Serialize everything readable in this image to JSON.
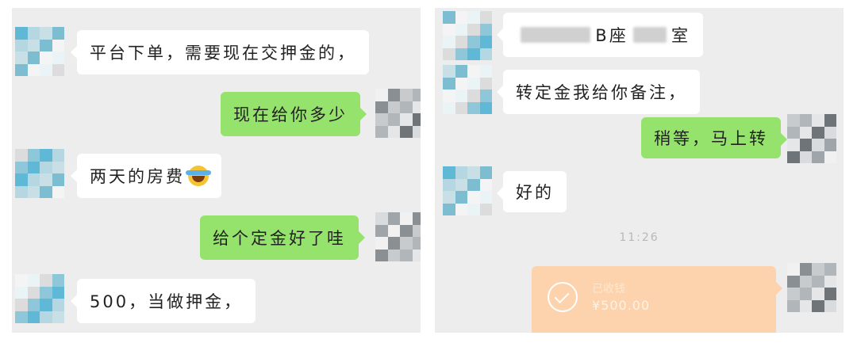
{
  "left_chat": {
    "messages": [
      {
        "side": "in",
        "text": "平台下单，需要现在交押金的，"
      },
      {
        "side": "out",
        "text": "现在给你多少"
      },
      {
        "side": "in",
        "text": "两天的房费",
        "emoji": "laughing-tears-emoji"
      },
      {
        "side": "out",
        "text": "给个定金好了哇"
      },
      {
        "side": "in",
        "text": "500，当做押金，"
      }
    ]
  },
  "right_chat": {
    "messages": [
      {
        "side": "in",
        "text_a": "B座",
        "text_b": "室",
        "redacted": true
      },
      {
        "side": "in",
        "text": "转定金我给你备注，"
      },
      {
        "side": "out",
        "text": "稍等，马上转"
      },
      {
        "side": "in",
        "text": "好的"
      }
    ],
    "timestamp": "11:26",
    "transfer": {
      "label": "已收钱",
      "amount": "¥500.00",
      "icon": "check-circle-icon"
    }
  },
  "colors": {
    "outgoing_bubble": "#95e36c",
    "incoming_bubble": "#ffffff",
    "chat_bg": "#ededed",
    "transfer_card": "#fcd3ac"
  }
}
